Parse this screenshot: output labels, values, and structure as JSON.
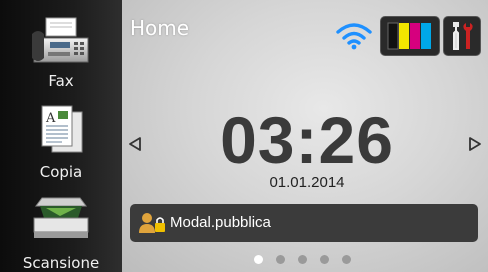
{
  "sidebar": {
    "items": [
      {
        "label": "Fax",
        "icon": "fax-icon"
      },
      {
        "label": "Copia",
        "icon": "copy-icon"
      },
      {
        "label": "Scansione",
        "icon": "scanner-icon"
      }
    ]
  },
  "header": {
    "title": "Home",
    "wifi_icon": "wifi-icon",
    "ink_icon": "ink-cartridges-icon",
    "tools_icon": "tools-icon"
  },
  "clock": {
    "time": "03:26",
    "date": "01.01.2014"
  },
  "mode": {
    "label": "Modal.pubblica",
    "icon": "user-lock-icon"
  },
  "pager": {
    "pages": 5,
    "current": 1
  },
  "colors": {
    "wifi": "#1e90ff",
    "ink_black": "#111111",
    "ink_yellow": "#f2e600",
    "ink_magenta": "#d6007e",
    "ink_cyan": "#00a8e8"
  }
}
